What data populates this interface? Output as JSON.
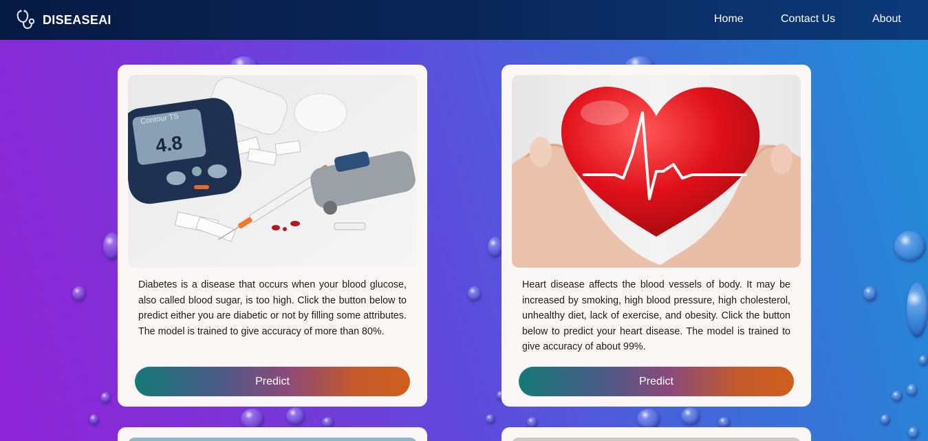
{
  "navbar": {
    "brand": "DISEASEAI",
    "links": [
      "Home",
      "Contact Us",
      "About"
    ]
  },
  "cards": [
    {
      "image_alt": "diabetes glucose meter and syringe",
      "meter_reading": "4.8",
      "meter_brand": "Contour TS",
      "description": "Diabetes is a disease that occurs when your blood glucose, also called blood sugar, is too high. Click the button below to predict either you are diabetic or not by filling some attributes. The model is trained to give accuracy of more than 80%.",
      "button": "Predict"
    },
    {
      "image_alt": "hands holding red heart with heartbeat line",
      "description": "Heart disease affects the blood vessels of body. It may be increased by smoking, high blood pressure, high cholesterol, unhealthy diet, lack of exercise, and obesity. Click the button below to predict your heart disease. The model is trained to give accuracy of about 99%.",
      "button": "Predict"
    }
  ],
  "colors": {
    "navbar": "#0a2658",
    "background_left": "#8e24d6",
    "background_right": "#1e90d6",
    "card": "#fbf7f6",
    "button_start": "#157a78",
    "button_end": "#cf5f1c"
  },
  "icons": [
    "stethoscope-icon"
  ]
}
